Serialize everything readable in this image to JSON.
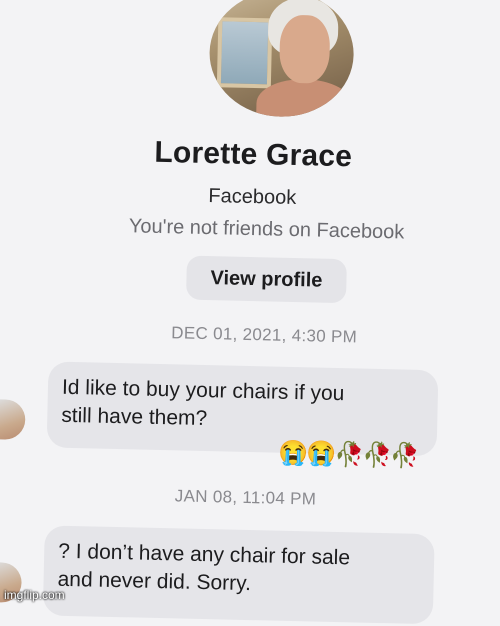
{
  "profile": {
    "name": "Lorette Grace",
    "platform": "Facebook",
    "relationship": "You're not friends on Facebook",
    "view_profile_label": "View profile"
  },
  "messages": [
    {
      "timestamp": "DEC 01, 2021, 4:30 PM",
      "lines": [
        "Id like to buy your chairs if you",
        "still have them?"
      ],
      "reactions": "😭😭🥀🥀🥀"
    },
    {
      "timestamp": "JAN 08, 11:04 PM",
      "lines": [
        "? I don’t have any chair for sale",
        "and never did. Sorry."
      ]
    }
  ],
  "watermark": "imgflip.com"
}
